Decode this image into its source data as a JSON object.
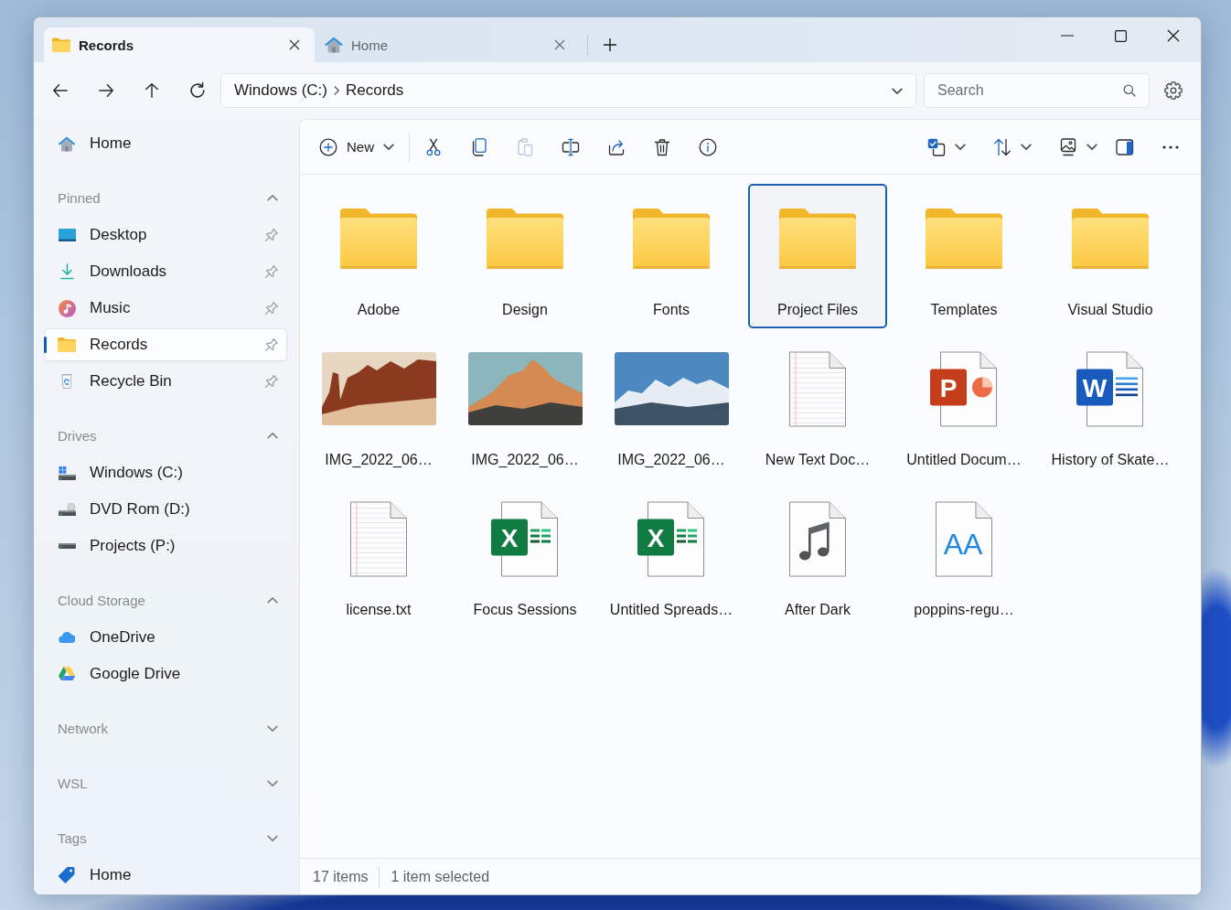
{
  "tabs": [
    {
      "label": "Records",
      "kind": "folder",
      "selected": true
    },
    {
      "label": "Home",
      "kind": "home",
      "selected": false
    }
  ],
  "address_bar": {
    "breadcrumbs": [
      "Windows (C:)",
      "Records"
    ]
  },
  "search": {
    "placeholder": "Search"
  },
  "sidebar": {
    "items": [
      {
        "label": "Home",
        "kind": "home",
        "pinned": false,
        "selected": false
      }
    ],
    "sections": [
      {
        "title": "Pinned",
        "expanded": true,
        "items": [
          {
            "label": "Desktop",
            "kind": "desktop",
            "pinned": true,
            "selected": false
          },
          {
            "label": "Downloads",
            "kind": "downloads",
            "pinned": true,
            "selected": false
          },
          {
            "label": "Music",
            "kind": "music",
            "pinned": true,
            "selected": false
          },
          {
            "label": "Records",
            "kind": "folder",
            "pinned": true,
            "selected": true
          },
          {
            "label": "Recycle Bin",
            "kind": "recyclebin",
            "pinned": true,
            "selected": false
          }
        ]
      },
      {
        "title": "Drives",
        "expanded": true,
        "items": [
          {
            "label": "Windows (C:)",
            "kind": "systemdrive",
            "pinned": false,
            "selected": false
          },
          {
            "label": "DVD Rom (D:)",
            "kind": "dvddrive",
            "pinned": false,
            "selected": false
          },
          {
            "label": "Projects (P:)",
            "kind": "drive",
            "pinned": false,
            "selected": false
          }
        ]
      },
      {
        "title": "Cloud Storage",
        "expanded": true,
        "items": [
          {
            "label": "OneDrive",
            "kind": "onedrive",
            "pinned": false,
            "selected": false
          },
          {
            "label": "Google Drive",
            "kind": "googledrive",
            "pinned": false,
            "selected": false
          }
        ]
      },
      {
        "title": "Network",
        "expanded": false
      },
      {
        "title": "WSL",
        "expanded": false
      },
      {
        "title": "Tags",
        "expanded": false,
        "items": [
          {
            "label": "Home",
            "kind": "tag",
            "pinned": false,
            "selected": false
          }
        ]
      }
    ]
  },
  "toolbar": {
    "left": [
      {
        "kind": "new",
        "label": "New",
        "dropdown": true,
        "disabled": false
      },
      {
        "kind": "separator"
      },
      {
        "kind": "cut",
        "dropdown": false,
        "disabled": false
      },
      {
        "kind": "copy",
        "dropdown": false,
        "disabled": false
      },
      {
        "kind": "paste",
        "dropdown": false,
        "disabled": true
      },
      {
        "kind": "rename",
        "dropdown": false,
        "disabled": false
      },
      {
        "kind": "share",
        "dropdown": false,
        "disabled": false
      },
      {
        "kind": "delete",
        "dropdown": false,
        "disabled": false
      },
      {
        "kind": "properties",
        "dropdown": false,
        "disabled": false
      }
    ],
    "right": [
      {
        "kind": "select",
        "dropdown": true,
        "disabled": false
      },
      {
        "kind": "sort",
        "dropdown": true,
        "disabled": false
      },
      {
        "kind": "view",
        "dropdown": true,
        "disabled": false
      },
      {
        "kind": "detailspane",
        "dropdown": false,
        "disabled": false
      },
      {
        "kind": "more",
        "dropdown": false,
        "disabled": false
      }
    ]
  },
  "files": [
    {
      "name": "Adobe",
      "kind": "folder",
      "selected": false
    },
    {
      "name": "Design",
      "kind": "folder",
      "selected": false
    },
    {
      "name": "Fonts",
      "kind": "folder",
      "selected": false
    },
    {
      "name": "Project Files",
      "kind": "folder",
      "selected": true
    },
    {
      "name": "Templates",
      "kind": "folder",
      "selected": false
    },
    {
      "name": "Visual Studio",
      "kind": "folder",
      "selected": false
    },
    {
      "name": "IMG_2022_06…",
      "kind": "photo",
      "selected": false
    },
    {
      "name": "IMG_2022_06…",
      "kind": "photo",
      "selected": false
    },
    {
      "name": "IMG_2022_06…",
      "kind": "photo",
      "selected": false
    },
    {
      "name": "New Text Doc…",
      "kind": "text",
      "selected": false
    },
    {
      "name": "Untitled Docum…",
      "kind": "presentation",
      "badge": "P",
      "selected": false
    },
    {
      "name": "History of Skate…",
      "kind": "document",
      "badge": "W",
      "selected": false
    },
    {
      "name": "license.txt",
      "kind": "text",
      "selected": false
    },
    {
      "name": "Focus Sessions",
      "kind": "spreadsheet",
      "badge": "X",
      "selected": false
    },
    {
      "name": "Untitled Spreads…",
      "kind": "spreadsheet",
      "badge": "X",
      "selected": false
    },
    {
      "name": "After Dark",
      "kind": "audio",
      "selected": false
    },
    {
      "name": "poppins-regu…",
      "kind": "font",
      "badge": "AA",
      "selected": false
    }
  ],
  "status_bar": {
    "item_count": "17 items",
    "selection": "1 item selected"
  }
}
